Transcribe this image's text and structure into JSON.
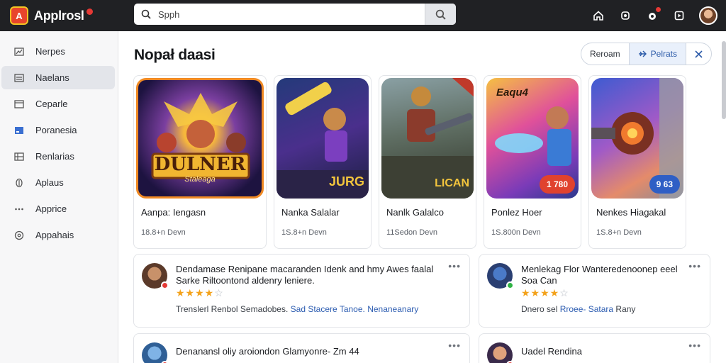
{
  "app": {
    "name": "Applrosl",
    "logo_letter": "A"
  },
  "search": {
    "placeholder": "Spph"
  },
  "sidebar": {
    "items": [
      {
        "label": "Nerpes",
        "icon": "chart-icon"
      },
      {
        "label": "Naelans",
        "icon": "list-icon"
      },
      {
        "label": "Ceparle",
        "icon": "window-icon"
      },
      {
        "label": "Poranesia",
        "icon": "panel-icon"
      },
      {
        "label": "Renlarias",
        "icon": "grid-icon"
      },
      {
        "label": "Aplaus",
        "icon": "circle-icon"
      },
      {
        "label": "Apprice",
        "icon": "dots-icon"
      },
      {
        "label": "Appahais",
        "icon": "clock-icon"
      }
    ]
  },
  "main": {
    "title": "Nopał daasi",
    "segments": {
      "left": "Reroam",
      "primary": "Pelrats",
      "primary_icon": "plane-icon",
      "close_icon": "close-icon"
    },
    "cards": [
      {
        "title": "Aanpa: Iengasn",
        "meta": "18.8+n Devn",
        "art_text": "DULNER",
        "art_sub": "Staleaga",
        "price": "",
        "badge_color": ""
      },
      {
        "title": "Nanka Salalar",
        "meta": "1S.8+n Devn",
        "art_text": "JURG",
        "art_sub": "",
        "price": "",
        "badge_color": ""
      },
      {
        "title": "Nanlk Galalco",
        "meta": "11Sedon Devn",
        "art_text": "LICAN",
        "art_sub": "",
        "price": "",
        "badge_color": ""
      },
      {
        "title": "Ponlez Hoer",
        "meta": "1S.800n Devn",
        "art_text": "Eaqu4",
        "art_sub": "",
        "price": "1 780",
        "badge_color": "#e0422e"
      },
      {
        "title": "Nenkes Hiagakal",
        "meta": "1S.8+n Devn",
        "art_text": "",
        "art_sub": "",
        "price": "9 63",
        "badge_color": "#2f5fc5"
      }
    ],
    "reviews": [
      {
        "line1": "Dendamase Renipane macaranden Idenk and hmy Awes faalal",
        "line2": "Sarke Riltoontond aldenry leniere.",
        "stars": 4,
        "foot_plain": "Trenslerl Renbol Semadobes.",
        "foot_hl1": "Sad Stacere Tanoe.",
        "foot_hl2": "Nenaneanary",
        "avatar_badge": "#e53935"
      },
      {
        "line1": "Menlekag Flor Wanteredenoonep eeel",
        "line2": "Soa Can",
        "stars": 4,
        "foot_plain": "Dnero sel",
        "foot_hl1": "Rroee- Satara",
        "foot_hl2": "Rany",
        "avatar_badge": "#2fb344"
      },
      {
        "line1": "Denanansl oliy aroiondon Glamyonre- Zm 44",
        "line2": "",
        "stars": 0,
        "foot_plain": "",
        "foot_hl1": "",
        "foot_hl2": "",
        "avatar_badge": "#e53935"
      },
      {
        "line1": "Uadel Rendina",
        "line2": "",
        "stars": 0,
        "foot_plain": "",
        "foot_hl1": "",
        "foot_hl2": "",
        "avatar_badge": "#e53935"
      }
    ],
    "more_label": "•••"
  },
  "colors": {
    "topbar": "#202124",
    "accent": "#2b5aa8",
    "star": "#f3a21b",
    "logo": "#e8452c"
  }
}
